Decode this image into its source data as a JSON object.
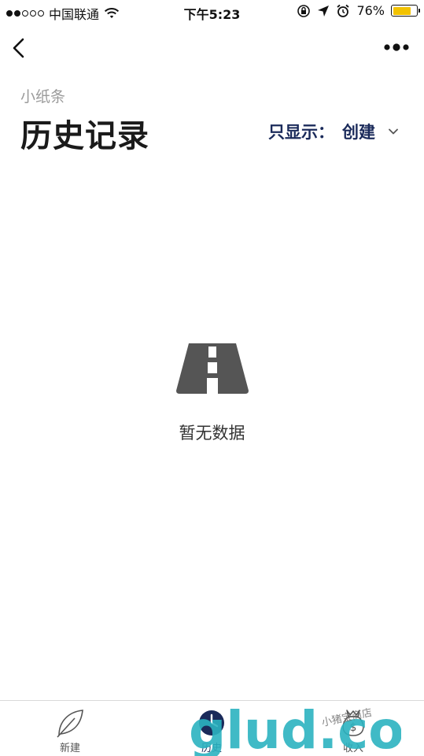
{
  "status_bar": {
    "carrier": "中国联通",
    "time": "下午5:23",
    "battery_percent_text": "76%",
    "battery_level": 0.76
  },
  "header": {
    "app_name": "小纸条",
    "title": "历史记录",
    "filter_label": "只显示：",
    "filter_value": "创建"
  },
  "empty_state": {
    "icon": "road-icon",
    "message": "暂无数据"
  },
  "tab_bar": {
    "tabs": [
      {
        "label": "新建",
        "icon": "leaf-icon"
      },
      {
        "label": "历史",
        "icon": "clock-icon"
      },
      {
        "label": "收入",
        "icon": "money-bag-icon"
      }
    ]
  },
  "watermark": {
    "text": "glud.com",
    "store_text": "小猪宝商店"
  },
  "colors": {
    "accent": "#1a2a5a",
    "muted": "#9b9b9b",
    "battery": "#f2c200",
    "icon_gray": "#555555"
  }
}
